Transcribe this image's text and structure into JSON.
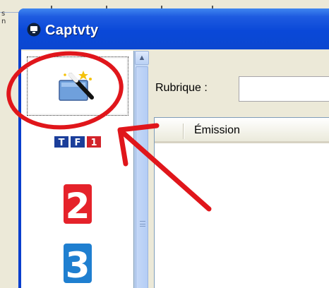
{
  "desktop": {
    "edge_text": "s\nn"
  },
  "window": {
    "title": "Captvty",
    "title_bar_color": "#0a48d8"
  },
  "sidebar": {
    "items": [
      {
        "id": "wizard",
        "icon": "magic-wand-icon",
        "selected": true
      },
      {
        "id": "tf1",
        "icon": "tf1-logo",
        "label": "TF1"
      },
      {
        "id": "france2",
        "icon": "france-2-logo",
        "label": "2"
      },
      {
        "id": "france3",
        "icon": "france-3-logo",
        "label": "3"
      }
    ]
  },
  "main": {
    "rubrique_label": "Rubrique :",
    "rubrique_value": "",
    "list_columns": [
      "",
      "Émission"
    ]
  },
  "annotation": {
    "color": "#e0161b",
    "shape": "circle-and-arrow"
  }
}
